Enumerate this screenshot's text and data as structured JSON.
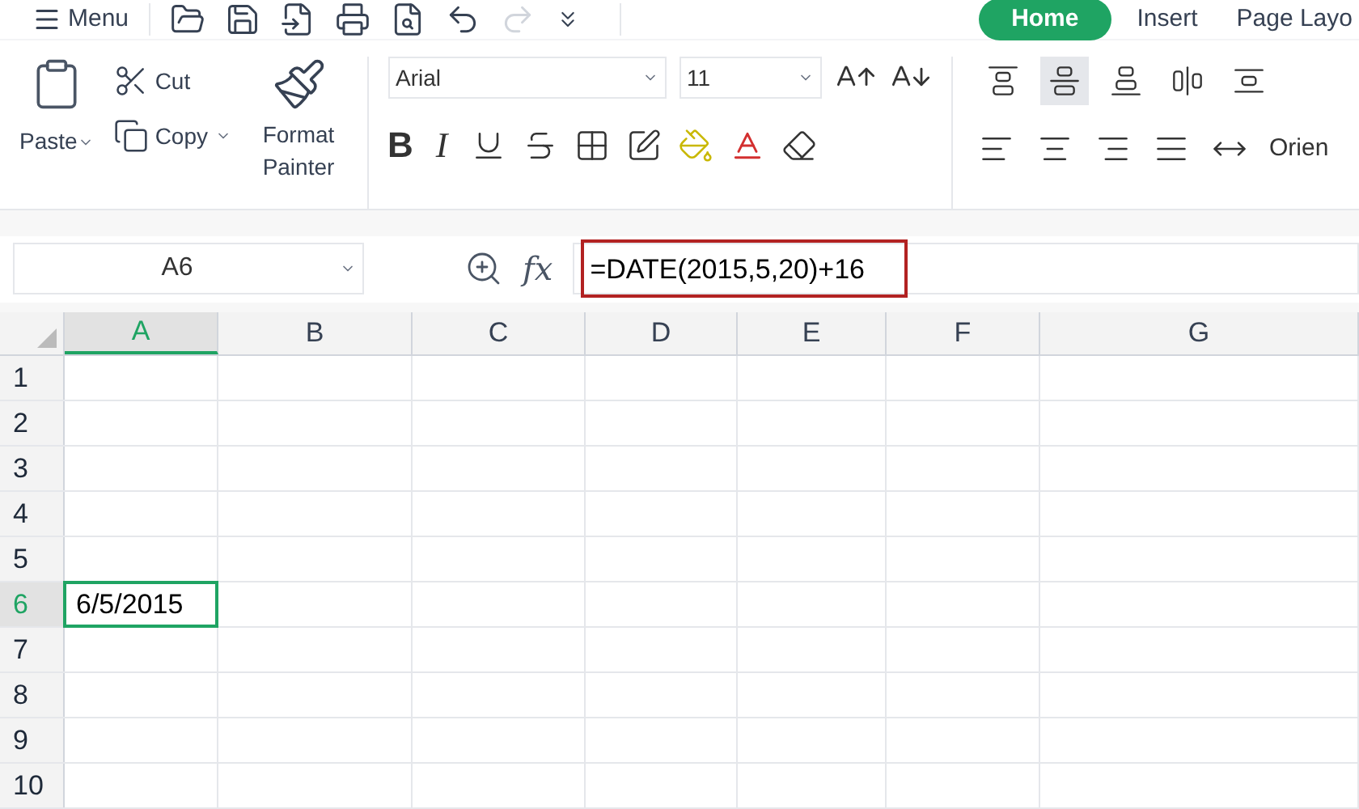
{
  "menu": {
    "label": "Menu"
  },
  "tabs": [
    {
      "label": "Home",
      "selected": true
    },
    {
      "label": "Insert",
      "selected": false
    },
    {
      "label": "Page Layo",
      "selected": false
    }
  ],
  "clipboard": {
    "paste": "Paste",
    "cut": "Cut",
    "copy": "Copy",
    "format_painter": "Format Painter"
  },
  "font": {
    "family": "Arial",
    "size": "11",
    "bold": "B",
    "italic": "I"
  },
  "vertical_alignment": [
    {
      "selected": false
    },
    {
      "selected": true
    },
    {
      "selected": false
    },
    {
      "selected": false
    },
    {
      "selected": false
    }
  ],
  "orientation": {
    "label": "Orien"
  },
  "formula_bar": {
    "cell_name": "A6",
    "function_label": "fx",
    "formula": "=DATE(2015,5,20)+16"
  },
  "grid": {
    "columns": [
      {
        "label": "A",
        "selected": true
      },
      {
        "label": "B",
        "selected": false
      },
      {
        "label": "C",
        "selected": false
      },
      {
        "label": "D",
        "selected": false
      },
      {
        "label": "E",
        "selected": false
      },
      {
        "label": "F",
        "selected": false
      },
      {
        "label": "G",
        "selected": false
      }
    ],
    "rows": [
      {
        "label": "1",
        "selected": false
      },
      {
        "label": "2",
        "selected": false
      },
      {
        "label": "3",
        "selected": false
      },
      {
        "label": "4",
        "selected": false
      },
      {
        "label": "5",
        "selected": false
      },
      {
        "label": "6",
        "selected": true,
        "cells": [
          {
            "value": "6/5/2015",
            "selected": true
          }
        ]
      },
      {
        "label": "7",
        "selected": false
      },
      {
        "label": "8",
        "selected": false
      },
      {
        "label": "9",
        "selected": false
      },
      {
        "label": "10",
        "selected": false
      }
    ]
  }
}
